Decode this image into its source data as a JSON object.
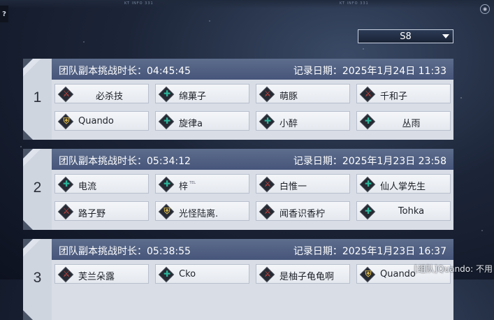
{
  "hud": {
    "left_text": "KT INFO 331",
    "right_text": "KT INFO 331"
  },
  "season_select": {
    "selected": "S8"
  },
  "duration_label": "团队副本挑战时长：",
  "date_label": "记录日期：",
  "records": [
    {
      "rank": "1",
      "duration": "04:45:45",
      "date": "2025年1月24日 11:33",
      "members": [
        {
          "name": "必杀技",
          "role": "dps",
          "center": true
        },
        {
          "name": "绵菓子",
          "role": "healer"
        },
        {
          "name": "萌豚",
          "role": "dps"
        },
        {
          "name": "千和子",
          "role": "dps"
        },
        {
          "name": "Quando",
          "role": "tank"
        },
        {
          "name": "旋律a",
          "role": "healer"
        },
        {
          "name": "小醉",
          "role": "healer"
        },
        {
          "name": "丛雨",
          "role": "healer",
          "center": true
        }
      ]
    },
    {
      "rank": "2",
      "duration": "05:34:12",
      "date": "2025年1月23日 23:58",
      "members": [
        {
          "name": "电流",
          "role": "healer"
        },
        {
          "name": "梓",
          "role": "healer",
          "tag": "TEL"
        },
        {
          "name": "白惟一",
          "role": "dps"
        },
        {
          "name": "仙人掌先生",
          "role": "healer"
        },
        {
          "name": "路子野",
          "role": "dps"
        },
        {
          "name": "光怪陆离.",
          "role": "tank"
        },
        {
          "name": "闻香识香柠",
          "role": "dps"
        },
        {
          "name": "Tohka",
          "role": "healer",
          "center": true
        }
      ]
    },
    {
      "rank": "3",
      "duration": "05:38:55",
      "date": "2025年1月23日 16:37",
      "members": [
        {
          "name": "芙兰朵露",
          "role": "dps"
        },
        {
          "name": "Cko",
          "role": "healer"
        },
        {
          "name": "是柚子龟龟啊",
          "role": "dps"
        },
        {
          "name": "Quando",
          "role": "tank"
        }
      ]
    }
  ],
  "chat": {
    "text": "[组队]Quando: 不用"
  },
  "colors": {
    "header": "#4e5e80",
    "dps": "#d04640",
    "healer": "#2ab59a",
    "tank": "#d3b34c"
  },
  "icons": {
    "dps": "sword-icon",
    "healer": "cross-icon",
    "tank": "shield-icon"
  }
}
